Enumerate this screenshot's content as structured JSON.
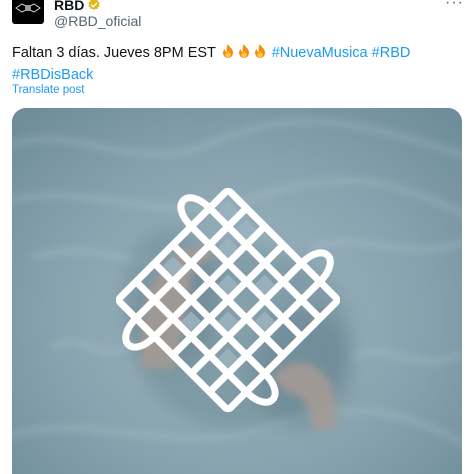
{
  "author": {
    "name": "RBD",
    "handle": "@RBD_oficial",
    "avatar_icon": "rbd-logo-icon",
    "verified_icon": "verified-badge-icon",
    "verified_color": "#e2b719"
  },
  "more_icon": "more-options-icon",
  "post": {
    "text_prefix": "Faltan 3 días. Jueves 8PM EST",
    "emojis": [
      "fire-emoji",
      "fire-emoji",
      "fire-emoji"
    ],
    "hashtags": [
      "#NuevaMusica",
      "#RBD",
      "#RBDisBack"
    ]
  },
  "translate_label": "Translate post",
  "media": {
    "icon": "endless-knot-icon",
    "description_colors": {
      "water": "#8fa9b5",
      "knot": "#ffffff"
    }
  },
  "colors": {
    "link": "#1d9bf0",
    "text": "#0f1419",
    "secondary": "#536471"
  }
}
